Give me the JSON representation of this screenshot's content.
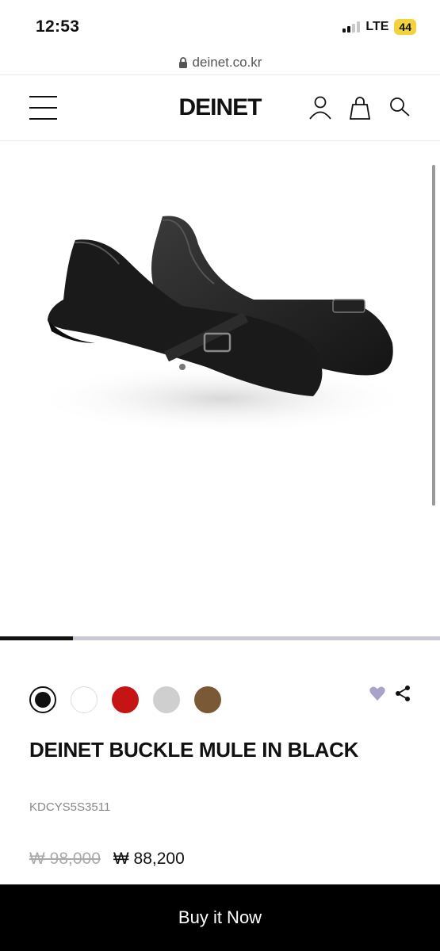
{
  "status": {
    "time": "12:53",
    "network": "LTE",
    "battery": "44"
  },
  "browser": {
    "url": "deinet.co.kr"
  },
  "header": {
    "brand": "DEINET"
  },
  "product": {
    "colors": [
      {
        "name": "black",
        "hex": "#111111",
        "selected": true
      },
      {
        "name": "white",
        "hex": "#ffffff",
        "selected": false
      },
      {
        "name": "red",
        "hex": "#c41414",
        "selected": false
      },
      {
        "name": "grey",
        "hex": "#cfcfcf",
        "selected": false
      },
      {
        "name": "brown",
        "hex": "#7a5a36",
        "selected": false
      }
    ],
    "title": "DEINET BUCKLE MULE IN BLACK",
    "sku": "KDCYS5S3511",
    "original_price": "₩ 98,000",
    "sale_price": "₩ 88,200",
    "image_progress": 0.166
  },
  "cta": {
    "buy_label": "Buy it Now"
  },
  "colors": {
    "accent": "#000000",
    "wishlist": "#a9a3c9"
  }
}
